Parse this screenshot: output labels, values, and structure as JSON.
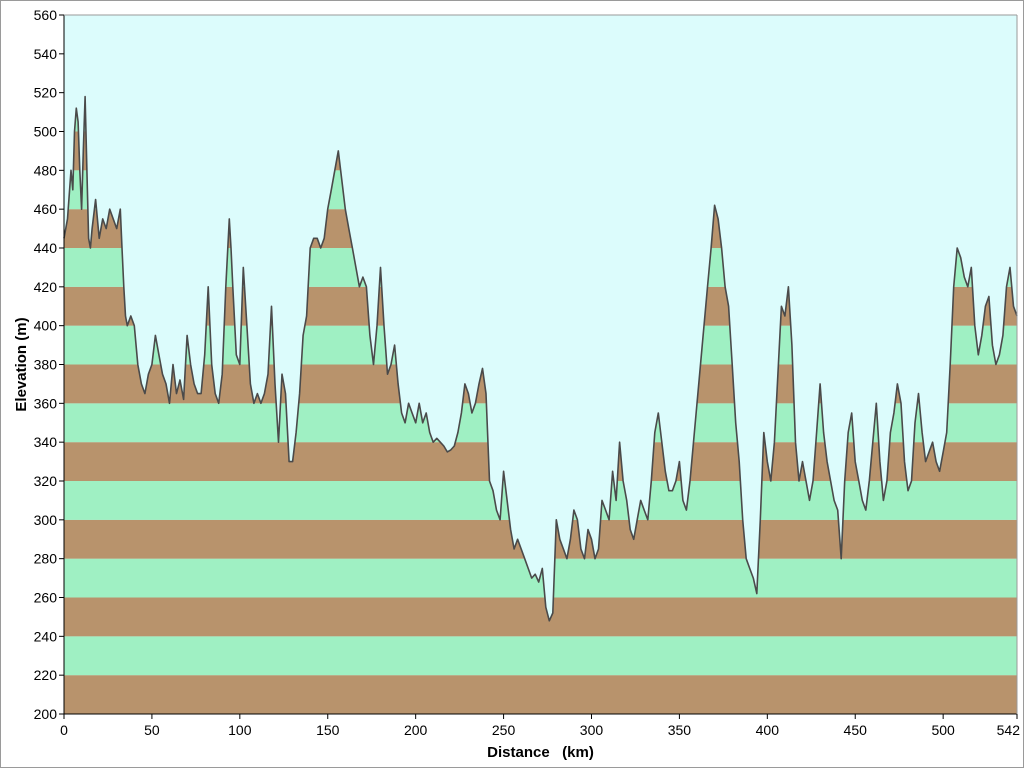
{
  "chart_data": {
    "type": "area",
    "xlabel": "Distance   (km)",
    "ylabel": "Elevation (m)",
    "xlim": [
      0,
      542
    ],
    "ylim": [
      200,
      560
    ],
    "x_ticks": [
      "0",
      "50",
      "100",
      "150",
      "200",
      "250",
      "300",
      "350",
      "400",
      "450",
      "500",
      "542"
    ],
    "y_ticks": [
      "200",
      "220",
      "240",
      "260",
      "280",
      "300",
      "320",
      "340",
      "360",
      "380",
      "400",
      "420",
      "440",
      "460",
      "480",
      "500",
      "520",
      "540",
      "560"
    ],
    "band_size": 20,
    "grid": false,
    "colors": {
      "sky": "#dcfcfc",
      "band_green": "#9ff0c3",
      "band_brown": "#b8936c",
      "profile_line": "#4a4a4a"
    },
    "series": [
      {
        "x": [
          0,
          2,
          4,
          5,
          6,
          7,
          8,
          9,
          10,
          11,
          12,
          13,
          14,
          15,
          16,
          18,
          20,
          22,
          24,
          26,
          28,
          30,
          32,
          33,
          34,
          35,
          36,
          38,
          40,
          42,
          44,
          46,
          48,
          50,
          52,
          54,
          56,
          58,
          60,
          62,
          64,
          66,
          68,
          70,
          72,
          74,
          76,
          78,
          80,
          82,
          84,
          86,
          88,
          90,
          92,
          94,
          95,
          96,
          98,
          100,
          102,
          104,
          106,
          108,
          110,
          112,
          114,
          116,
          118,
          120,
          122,
          124,
          126,
          128,
          130,
          132,
          134,
          136,
          138,
          140,
          142,
          144,
          146,
          148,
          150,
          152,
          154,
          156,
          158,
          160,
          162,
          164,
          166,
          168,
          170,
          172,
          174,
          176,
          178,
          180,
          182,
          184,
          186,
          188,
          190,
          192,
          194,
          196,
          198,
          200,
          202,
          204,
          206,
          208,
          210,
          212,
          214,
          216,
          218,
          220,
          222,
          224,
          226,
          228,
          230,
          232,
          234,
          236,
          238,
          240,
          242,
          244,
          246,
          248,
          250,
          252,
          254,
          256,
          258,
          260,
          262,
          264,
          266,
          268,
          270,
          272,
          274,
          276,
          278,
          280,
          282,
          284,
          286,
          288,
          290,
          292,
          294,
          296,
          298,
          300,
          302,
          304,
          306,
          308,
          310,
          312,
          314,
          316,
          318,
          320,
          322,
          324,
          326,
          328,
          330,
          332,
          334,
          336,
          338,
          340,
          342,
          344,
          346,
          348,
          350,
          352,
          354,
          356,
          358,
          360,
          362,
          364,
          366,
          368,
          370,
          372,
          374,
          376,
          378,
          380,
          382,
          384,
          386,
          388,
          390,
          392,
          394,
          396,
          398,
          400,
          402,
          404,
          406,
          408,
          410,
          412,
          414,
          416,
          418,
          420,
          422,
          424,
          426,
          428,
          430,
          432,
          434,
          436,
          438,
          440,
          442,
          444,
          446,
          448,
          450,
          452,
          454,
          456,
          458,
          460,
          462,
          464,
          466,
          468,
          470,
          472,
          474,
          476,
          478,
          480,
          482,
          484,
          486,
          488,
          490,
          492,
          494,
          496,
          498,
          500,
          502,
          504,
          506,
          508,
          510,
          512,
          514,
          516,
          518,
          520,
          522,
          524,
          526,
          528,
          530,
          532,
          534,
          536,
          538,
          540,
          542
        ],
        "y": [
          445,
          455,
          480,
          470,
          500,
          512,
          505,
          480,
          460,
          490,
          518,
          480,
          445,
          440,
          450,
          465,
          445,
          455,
          450,
          460,
          455,
          450,
          460,
          440,
          420,
          405,
          400,
          405,
          400,
          380,
          370,
          365,
          375,
          380,
          395,
          385,
          375,
          370,
          360,
          380,
          365,
          372,
          362,
          395,
          380,
          370,
          365,
          365,
          385,
          420,
          380,
          365,
          360,
          375,
          420,
          455,
          440,
          420,
          385,
          380,
          430,
          400,
          370,
          360,
          365,
          360,
          365,
          375,
          410,
          370,
          340,
          375,
          365,
          330,
          330,
          345,
          365,
          395,
          405,
          440,
          445,
          445,
          440,
          445,
          460,
          470,
          480,
          490,
          475,
          460,
          450,
          440,
          430,
          420,
          425,
          420,
          395,
          380,
          400,
          430,
          400,
          375,
          380,
          390,
          370,
          355,
          350,
          360,
          355,
          350,
          360,
          350,
          355,
          345,
          340,
          342,
          340,
          338,
          335,
          336,
          338,
          345,
          355,
          370,
          365,
          355,
          360,
          370,
          378,
          365,
          320,
          315,
          305,
          300,
          325,
          310,
          295,
          285,
          290,
          285,
          280,
          275,
          270,
          272,
          268,
          275,
          255,
          248,
          252,
          300,
          290,
          285,
          280,
          290,
          305,
          300,
          285,
          280,
          295,
          290,
          280,
          285,
          310,
          305,
          300,
          325,
          310,
          340,
          320,
          310,
          295,
          290,
          300,
          310,
          305,
          300,
          320,
          345,
          355,
          340,
          325,
          315,
          315,
          320,
          330,
          310,
          305,
          320,
          340,
          360,
          380,
          400,
          420,
          440,
          462,
          455,
          440,
          420,
          410,
          380,
          350,
          330,
          300,
          280,
          275,
          270,
          262,
          300,
          345,
          330,
          320,
          340,
          375,
          410,
          405,
          420,
          390,
          340,
          320,
          330,
          320,
          310,
          320,
          345,
          370,
          345,
          330,
          320,
          310,
          305,
          280,
          320,
          345,
          355,
          330,
          320,
          310,
          305,
          320,
          340,
          360,
          330,
          310,
          320,
          345,
          355,
          370,
          360,
          330,
          315,
          320,
          350,
          365,
          345,
          330,
          335,
          340,
          330,
          325,
          335,
          345,
          380,
          420,
          440,
          435,
          425,
          420,
          430,
          400,
          385,
          395,
          410,
          415,
          390,
          380,
          385,
          395,
          420,
          430,
          410,
          405
        ]
      }
    ]
  }
}
